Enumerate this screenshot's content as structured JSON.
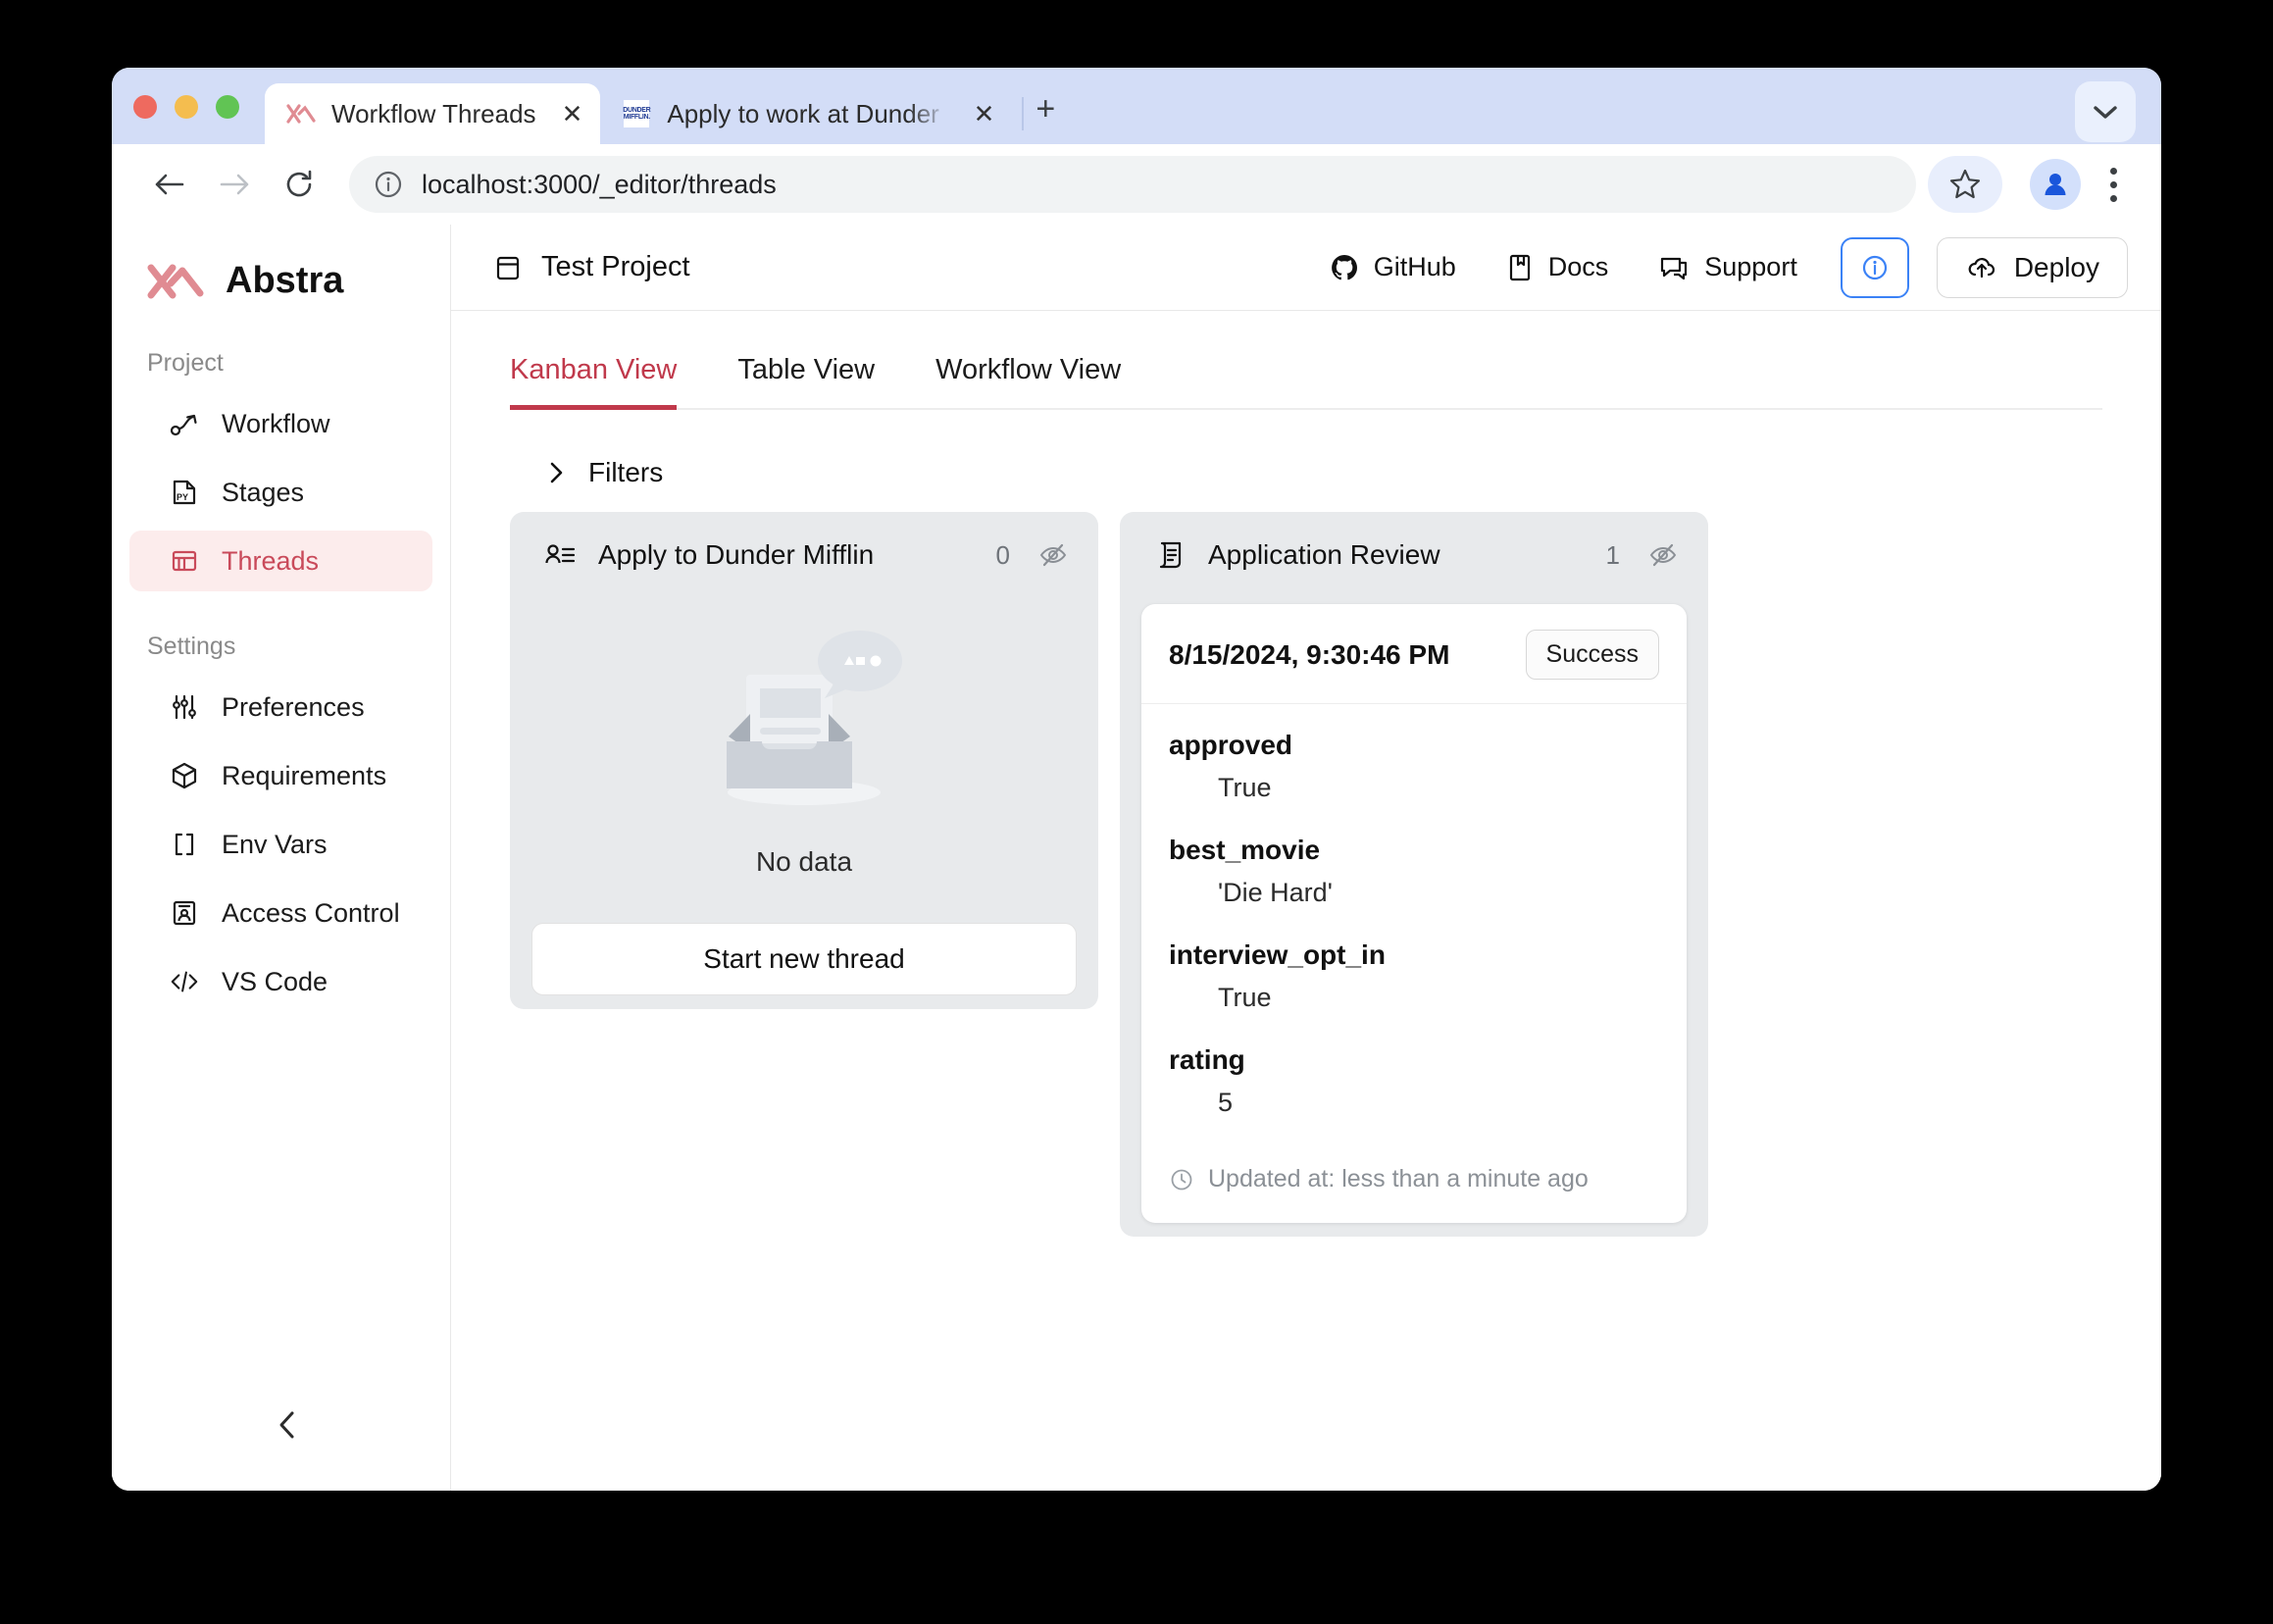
{
  "browser": {
    "tabs": [
      {
        "title": "Workflow Threads",
        "favicon": "abstra-logo-icon",
        "active": true,
        "close_label": "✕"
      },
      {
        "title": "Apply to work at Dunder Miffli",
        "favicon": "dunder-mifflin-icon",
        "active": false,
        "close_label": "✕"
      }
    ],
    "new_tab_label": "+",
    "url": "localhost:3000/_editor/threads",
    "site_info_icon": "info-circle-icon",
    "back_icon": "arrow-left-icon",
    "forward_icon": "arrow-right-icon",
    "reload_icon": "reload-icon",
    "bookmark_icon": "star-icon",
    "profile_icon": "account-avatar-icon",
    "menu_icon": "three-dot-menu-icon",
    "tab_list_icon": "chevron-down-icon"
  },
  "sidebar": {
    "brand": "Abstra",
    "brand_icon": "abstra-logo-icon",
    "groups": [
      {
        "title": "Project",
        "items": [
          {
            "label": "Workflow",
            "icon": "workflow-node-icon",
            "active": false
          },
          {
            "label": "Stages",
            "icon": "python-file-icon",
            "active": false
          },
          {
            "label": "Threads",
            "icon": "kanban-board-icon",
            "active": true
          }
        ]
      },
      {
        "title": "Settings",
        "items": [
          {
            "label": "Preferences",
            "icon": "sliders-icon",
            "active": false
          },
          {
            "label": "Requirements",
            "icon": "package-box-icon",
            "active": false
          },
          {
            "label": "Env Vars",
            "icon": "brackets-icon",
            "active": false
          },
          {
            "label": "Access Control",
            "icon": "id-badge-icon",
            "active": false
          },
          {
            "label": "VS Code",
            "icon": "code-tags-icon",
            "active": false
          }
        ]
      }
    ],
    "collapse_icon": "chevron-left-icon"
  },
  "topbar": {
    "project_name": "Test Project",
    "project_icon": "window-panel-icon",
    "links": [
      {
        "label": "GitHub",
        "icon": "github-icon"
      },
      {
        "label": "Docs",
        "icon": "book-icon"
      },
      {
        "label": "Support",
        "icon": "chat-bubbles-icon"
      }
    ],
    "info_button_icon": "info-circle-icon",
    "deploy_label": "Deploy",
    "deploy_icon": "cloud-upload-icon"
  },
  "main": {
    "view_tabs": [
      {
        "label": "Kanban View",
        "active": true
      },
      {
        "label": "Table View",
        "active": false
      },
      {
        "label": "Workflow View",
        "active": false
      }
    ],
    "filters": {
      "label": "Filters",
      "icon": "chevron-right-icon",
      "expanded": false
    },
    "columns": [
      {
        "title": "Apply to Dunder Mifflin",
        "icon": "form-person-icon",
        "count": "0",
        "visibility_icon": "eye-off-icon",
        "empty": {
          "illustration": "empty-inbox-illustration",
          "text": "No data",
          "button_label": "Start new thread"
        },
        "cards": []
      },
      {
        "title": "Application Review",
        "icon": "scroll-document-icon",
        "count": "1",
        "visibility_icon": "eye-off-icon",
        "cards": [
          {
            "date": "8/15/2024, 9:30:46 PM",
            "status": "Success",
            "fields": [
              {
                "key": "approved",
                "value": "True"
              },
              {
                "key": "best_movie",
                "value": "'Die Hard'"
              },
              {
                "key": "interview_opt_in",
                "value": "True"
              },
              {
                "key": "rating",
                "value": "5"
              }
            ],
            "updated_icon": "clock-icon",
            "updated_text": "Updated at: less than a minute ago"
          }
        ]
      }
    ]
  },
  "colors": {
    "brand_red": "#c0394b",
    "accent_blue": "#3b82f6",
    "tabstrip": "#d3ddf7",
    "column_bg": "#e8eaec"
  }
}
